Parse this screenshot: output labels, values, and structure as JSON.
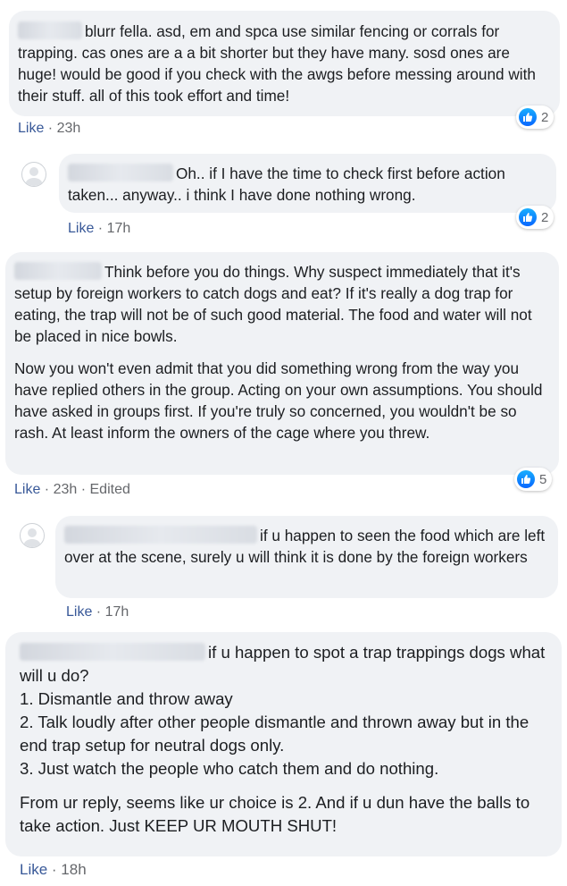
{
  "comments": [
    {
      "text": "blurr fella. asd, em and spca use similar fencing or corrals for trapping. cas ones are a a bit shorter but they have many. sosd ones are huge! would be good if you check with the awgs before messing around with their stuff. all of this took effort and time!",
      "like_label": "Like",
      "time": "23h",
      "reaction_count": "2"
    },
    {
      "text": "Oh.. if I have the time to check first before action taken... anyway.. i think I have done nothing wrong.",
      "like_label": "Like",
      "time": "17h",
      "reaction_count": "2"
    },
    {
      "text": "Think before you do things. Why suspect immediately that it's setup by foreign workers to catch dogs and eat? If it's really a dog trap for eating, the trap will not be of such good material. The food and water will not be placed in nice bowls.",
      "text2": "Now you won't even admit that you did something wrong from the way you have replied others in the group. Acting on your own assumptions. You should have asked in groups first. If you're truly so concerned, you wouldn't be so rash. At least inform the owners of the cage where you threw.",
      "like_label": "Like",
      "time": "23h",
      "edited": "Edited",
      "reaction_count": "5"
    },
    {
      "text": "if u happen to seen the food which are left over at the scene, surely u will think it is done by the foreign workers",
      "like_label": "Like",
      "time": "17h"
    },
    {
      "text": "if u happen to spot a trap trappings dogs what will u do?",
      "lines": [
        "1. Dismantle and throw away",
        "2. Talk loudly after other people dismantle and thrown away but in the end trap setup for neutral dogs only.",
        "3. Just watch the people who catch them and do nothing."
      ],
      "text2": "From ur reply, seems like ur choice is 2. And if u dun have the balls to take action. Just KEEP UR MOUTH SHUT!",
      "like_label": "Like",
      "time": "18h"
    }
  ]
}
